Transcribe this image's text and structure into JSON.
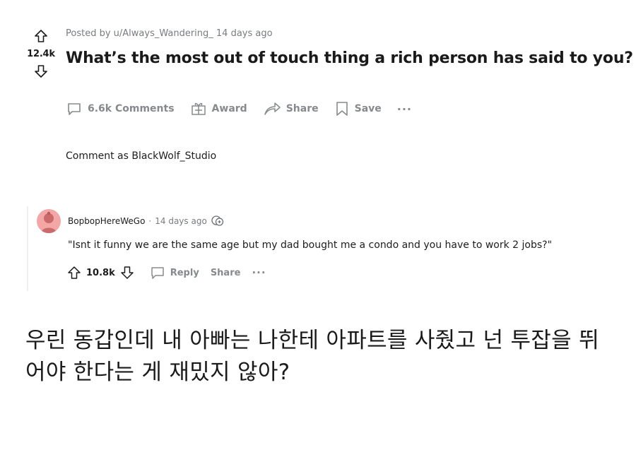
{
  "post": {
    "meta": "Posted by u/Always_Wandering_ 14 days ago",
    "score": "12.4k",
    "title": "What’s the most out of touch thing a rich person has said to you?"
  },
  "actions": {
    "comments": "6.6k Comments",
    "award": "Award",
    "share": "Share",
    "save": "Save",
    "more": "···"
  },
  "comment_as": "Comment as BlackWolf_Studio",
  "comment": {
    "username": "BopbopHereWeGo",
    "separator": "·",
    "time": "14 days ago",
    "body": "\"Isnt it funny we are the same age but my dad bought me a condo and you have to work 2 jobs?\"",
    "score": "10.8k",
    "reply": "Reply",
    "share": "Share",
    "more": "···"
  },
  "caption": "우린 동갑인데 내 아빠는 나한테 아파트를 사줬고 넌 투잡을 뛰어야 한다는 게 재밌지 않아?",
  "icons": [
    "upvote-icon",
    "downvote-icon",
    "comment-icon",
    "award-icon",
    "share-icon",
    "save-icon",
    "more-icon",
    "avatar",
    "award-badge-icon"
  ],
  "colors": {
    "meta": "#787c7e",
    "actions": "#878a8c",
    "avatar": "#f4a5a5"
  }
}
